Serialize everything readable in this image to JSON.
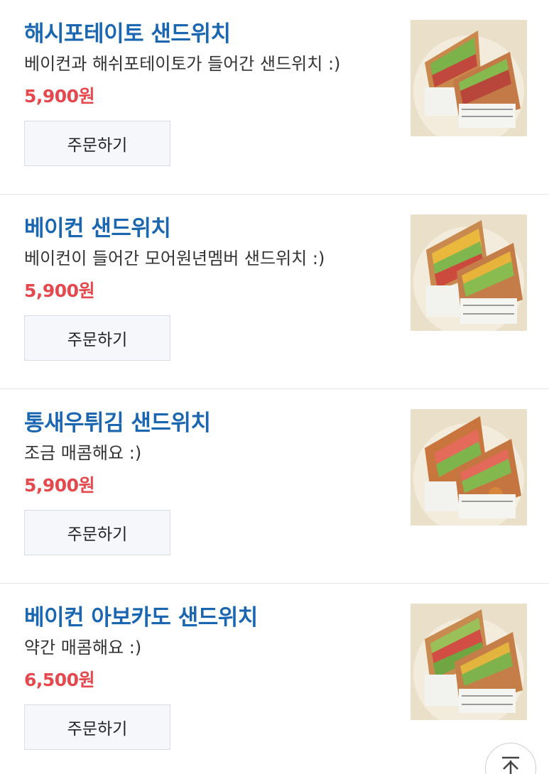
{
  "menu_items": [
    {
      "title": "해시포테이토 샌드위치",
      "description": "베이컨과 해쉬포테이토가 들어간 샌드위치 :)",
      "price": "5,900원",
      "order_label": "주문하기",
      "image": "sandwich-photo"
    },
    {
      "title": "베이컨 샌드위치",
      "description": "베이컨이 들어간 모어원년멤버 샌드위치 :)",
      "price": "5,900원",
      "order_label": "주문하기",
      "image": "sandwich-photo"
    },
    {
      "title": "통새우튀김 샌드위치",
      "description": "조금 매콤해요 :)",
      "price": "5,900원",
      "order_label": "주문하기",
      "image": "sandwich-photo"
    },
    {
      "title": "베이컨 아보카도 샌드위치",
      "description": "약간 매콤해요 :)",
      "price": "6,500원",
      "order_label": "주문하기",
      "image": "sandwich-photo"
    }
  ],
  "scroll_top": {
    "icon": "arrow-up-to-top-icon"
  },
  "colors": {
    "title": "#1b66b0",
    "price": "#e5484d",
    "button_bg": "#f5f7fa",
    "divider": "#e6e6e6"
  }
}
